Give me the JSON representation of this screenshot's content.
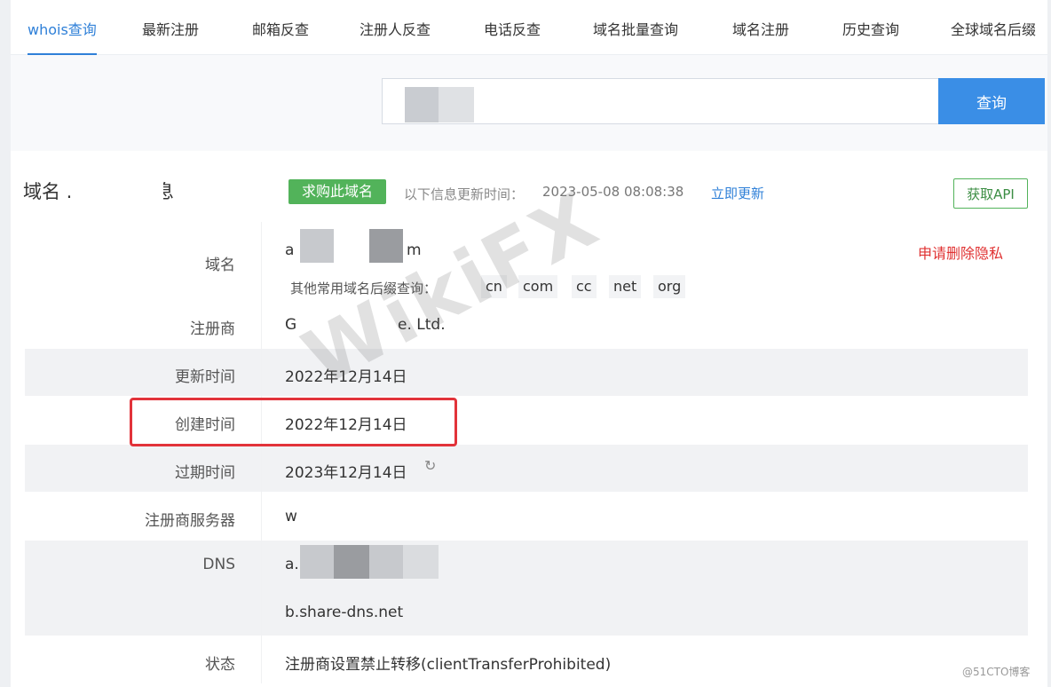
{
  "tabs": [
    {
      "label": "whois查询",
      "active": true
    },
    {
      "label": "最新注册"
    },
    {
      "label": "邮箱反查"
    },
    {
      "label": "注册人反查"
    },
    {
      "label": "电话反查"
    },
    {
      "label": "域名批量查询"
    },
    {
      "label": "域名注册"
    },
    {
      "label": "历史查询"
    },
    {
      "label": "全球域名后缀"
    }
  ],
  "search": {
    "value": "",
    "button_label": "查询"
  },
  "header": {
    "title": "域名           .com 的信息",
    "buy_label": "求购此域名",
    "update_label": "以下信息更新时间：",
    "update_time": "2023-05-08 08:08:38",
    "update_link": "立即更新",
    "api_label": "获取API"
  },
  "domain_row": {
    "label": "域名",
    "value_start": "a",
    "value_end": "m",
    "suffix_label": "其他常用域名后缀查询：",
    "suffixes": [
      "cn",
      "com",
      "cc",
      "net",
      "org"
    ],
    "privacy_link": "申请删除隐私"
  },
  "registrar_row": {
    "label": "注册商",
    "value_start": "G",
    "value_end": "e. Ltd."
  },
  "updated_row": {
    "label": "更新时间",
    "value": "2022年12月14日"
  },
  "created_row": {
    "label": "创建时间",
    "value": "2022年12月14日"
  },
  "expiry_row": {
    "label": "过期时间",
    "value": "2023年12月14日"
  },
  "server_row": {
    "label": "注册商服务器",
    "value": "w"
  },
  "dns_row": {
    "label": "DNS",
    "value1": "a.",
    "value2": "b.share-dns.net"
  },
  "status_row": {
    "label": "状态",
    "value": "注册商设置禁止转移(clientTransferProhibited)"
  },
  "watermark": "WikiFX",
  "source_mark": "@51CTO博客",
  "colors": {
    "accent": "#3a8ee6",
    "buy": "#52b35a",
    "danger": "#e03232",
    "highlight": "#e2333a"
  }
}
